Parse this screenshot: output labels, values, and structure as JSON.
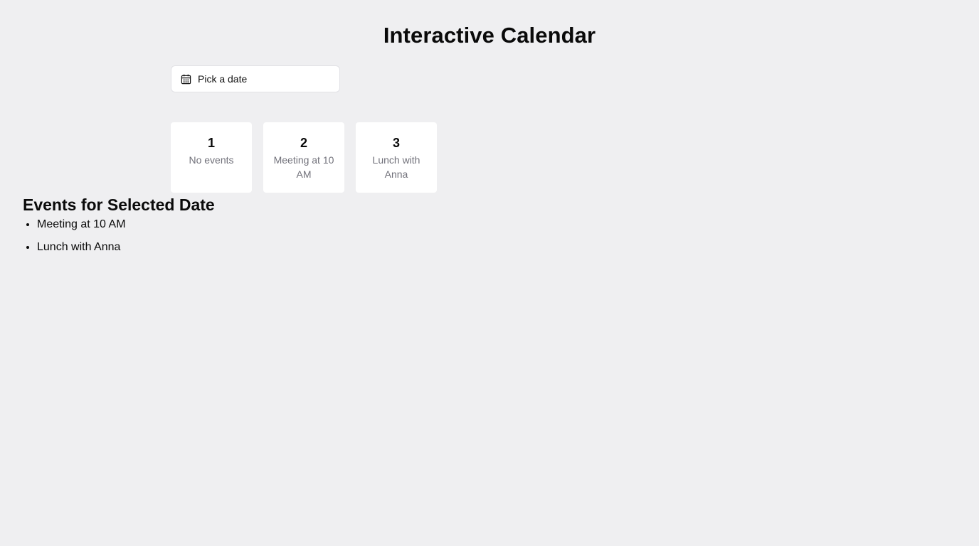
{
  "page": {
    "title": "Interactive Calendar"
  },
  "date_picker": {
    "icon": "calendar-icon",
    "placeholder": "Pick a date"
  },
  "days": [
    {
      "number": "1",
      "event": "No events"
    },
    {
      "number": "2",
      "event": "Meeting at 10 AM"
    },
    {
      "number": "3",
      "event": "Lunch with Anna"
    }
  ],
  "events": {
    "heading": "Events for Selected Date",
    "items": [
      "Meeting at 10 AM",
      "Lunch with Anna"
    ]
  },
  "colors": {
    "background": "#efeff1",
    "card": "#ffffff",
    "muted_text": "#71717a"
  }
}
